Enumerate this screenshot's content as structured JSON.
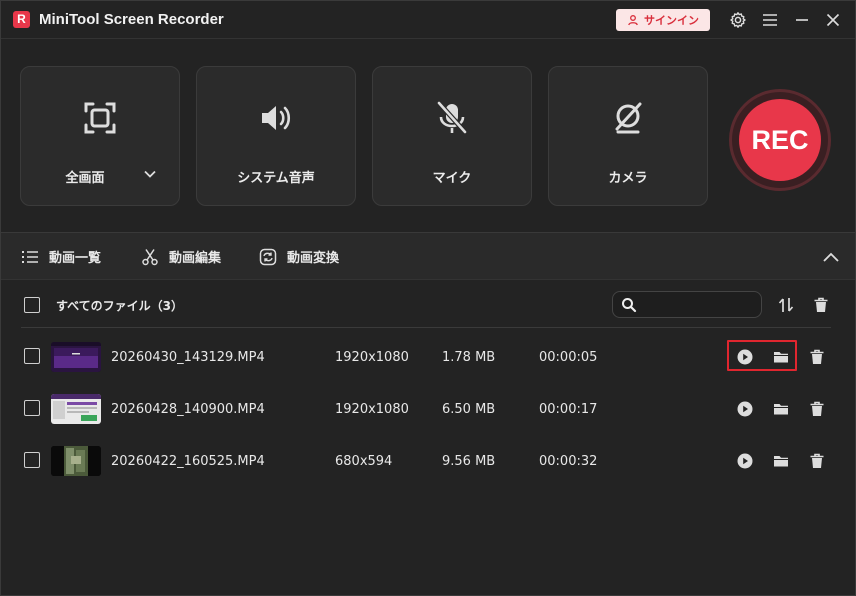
{
  "app": {
    "title": "MiniTool Screen Recorder",
    "logo_letter": "R",
    "signin_label": "サインイン"
  },
  "titlebar_icons": [
    "gear-icon",
    "menu-icon",
    "minimize-icon",
    "close-icon"
  ],
  "cards": [
    {
      "label": "全画面",
      "icon": "fullscreen-icon"
    },
    {
      "label": "システム音声",
      "icon": "speaker-icon"
    },
    {
      "label": "マイク",
      "icon": "mic-muted-icon"
    },
    {
      "label": "カメラ",
      "icon": "camera-off-icon"
    }
  ],
  "rec_label": "REC",
  "tabs": [
    {
      "label": "動画一覧",
      "icon": "list-icon"
    },
    {
      "label": "動画編集",
      "icon": "scissors-icon"
    },
    {
      "label": "動画変換",
      "icon": "convert-icon"
    }
  ],
  "list": {
    "all_files_label": "すべてのファイル（3）",
    "search_value": "",
    "files": [
      {
        "name": "20260430_143129.MP4",
        "resolution": "1920x1080",
        "size": "1.78 MB",
        "duration": "00:00:05"
      },
      {
        "name": "20260428_140900.MP4",
        "resolution": "1920x1080",
        "size": "6.50 MB",
        "duration": "00:00:17"
      },
      {
        "name": "20260422_160525.MP4",
        "resolution": "680x594",
        "size": "9.56 MB",
        "duration": "00:00:32"
      }
    ]
  },
  "colors": {
    "accent": "#e8374a",
    "background": "#232323",
    "highlight_box": "#e0262f"
  }
}
